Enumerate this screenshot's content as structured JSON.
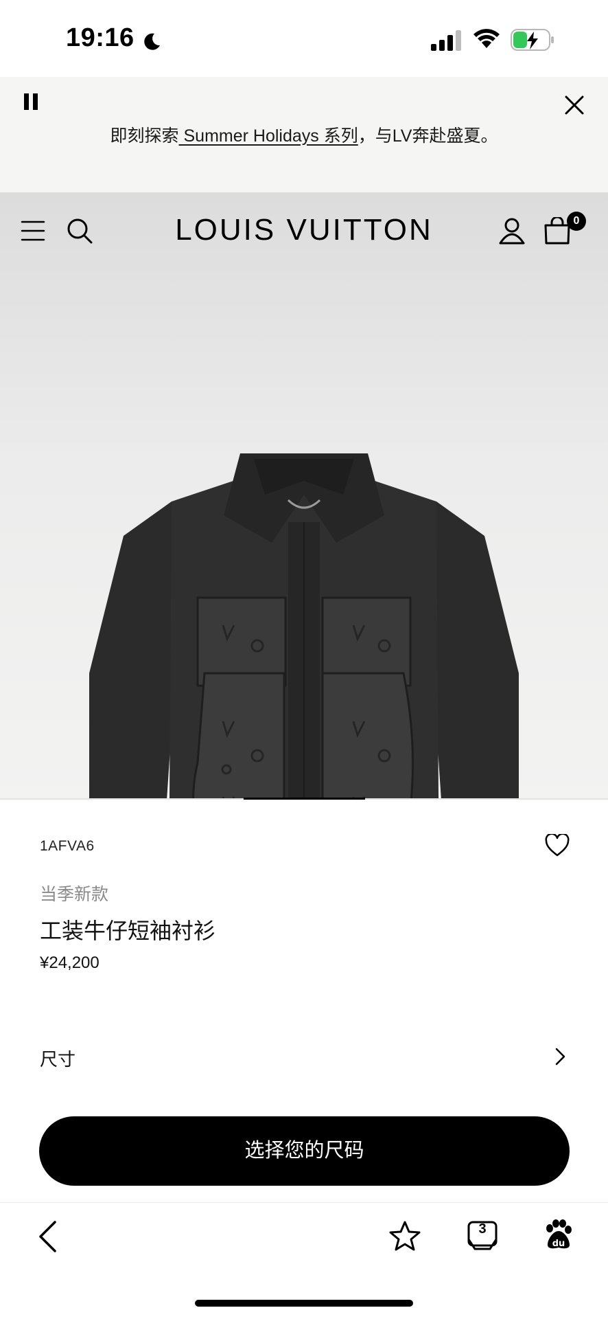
{
  "status_bar": {
    "time": "19:16",
    "battery_color": "#34c759"
  },
  "banner": {
    "text_before": "即刻探索",
    "link_text": " Summer Holidays 系列",
    "text_after": "，与LV奔赴盛夏。"
  },
  "header": {
    "brand": "LOUIS VUITTON",
    "bag_count": "0"
  },
  "product": {
    "sku": "1AFVA6",
    "tag": "当季新款",
    "name": "工装牛仔短袖衬衫",
    "price": "¥24,200",
    "image_count": 5,
    "current_image": 3
  },
  "size": {
    "label": "尺寸"
  },
  "cta": {
    "label": "选择您的尺码"
  },
  "toolbar": {
    "tab_count": "3",
    "items": [
      "back-icon",
      "star-icon",
      "tabs-icon",
      "baidu-icon"
    ]
  }
}
